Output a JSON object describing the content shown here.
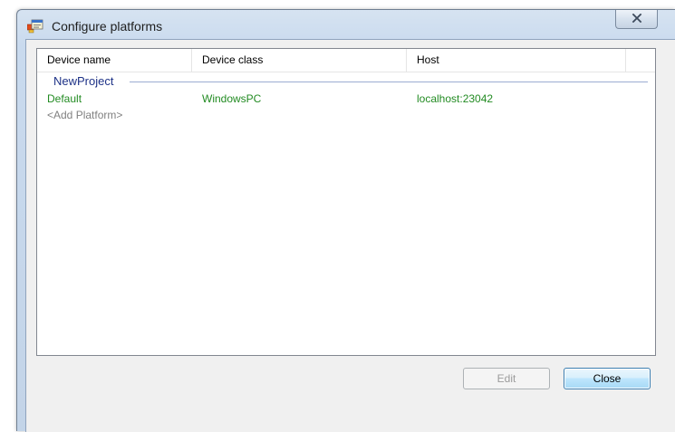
{
  "window": {
    "title": "Configure platforms",
    "icon": "configure-app-icon",
    "close_icon": "close-icon"
  },
  "list": {
    "columns": [
      "Device name",
      "Device class",
      "Host"
    ],
    "group": {
      "label": "NewProject"
    },
    "rows": [
      {
        "device_name": "Default",
        "device_class": "WindowsPC",
        "host": "localhost:23042",
        "color": "#228b22"
      }
    ],
    "add_item": "<Add Platform>"
  },
  "buttons": {
    "edit_label": "Edit",
    "edit_enabled": false,
    "close_label": "Close"
  }
}
